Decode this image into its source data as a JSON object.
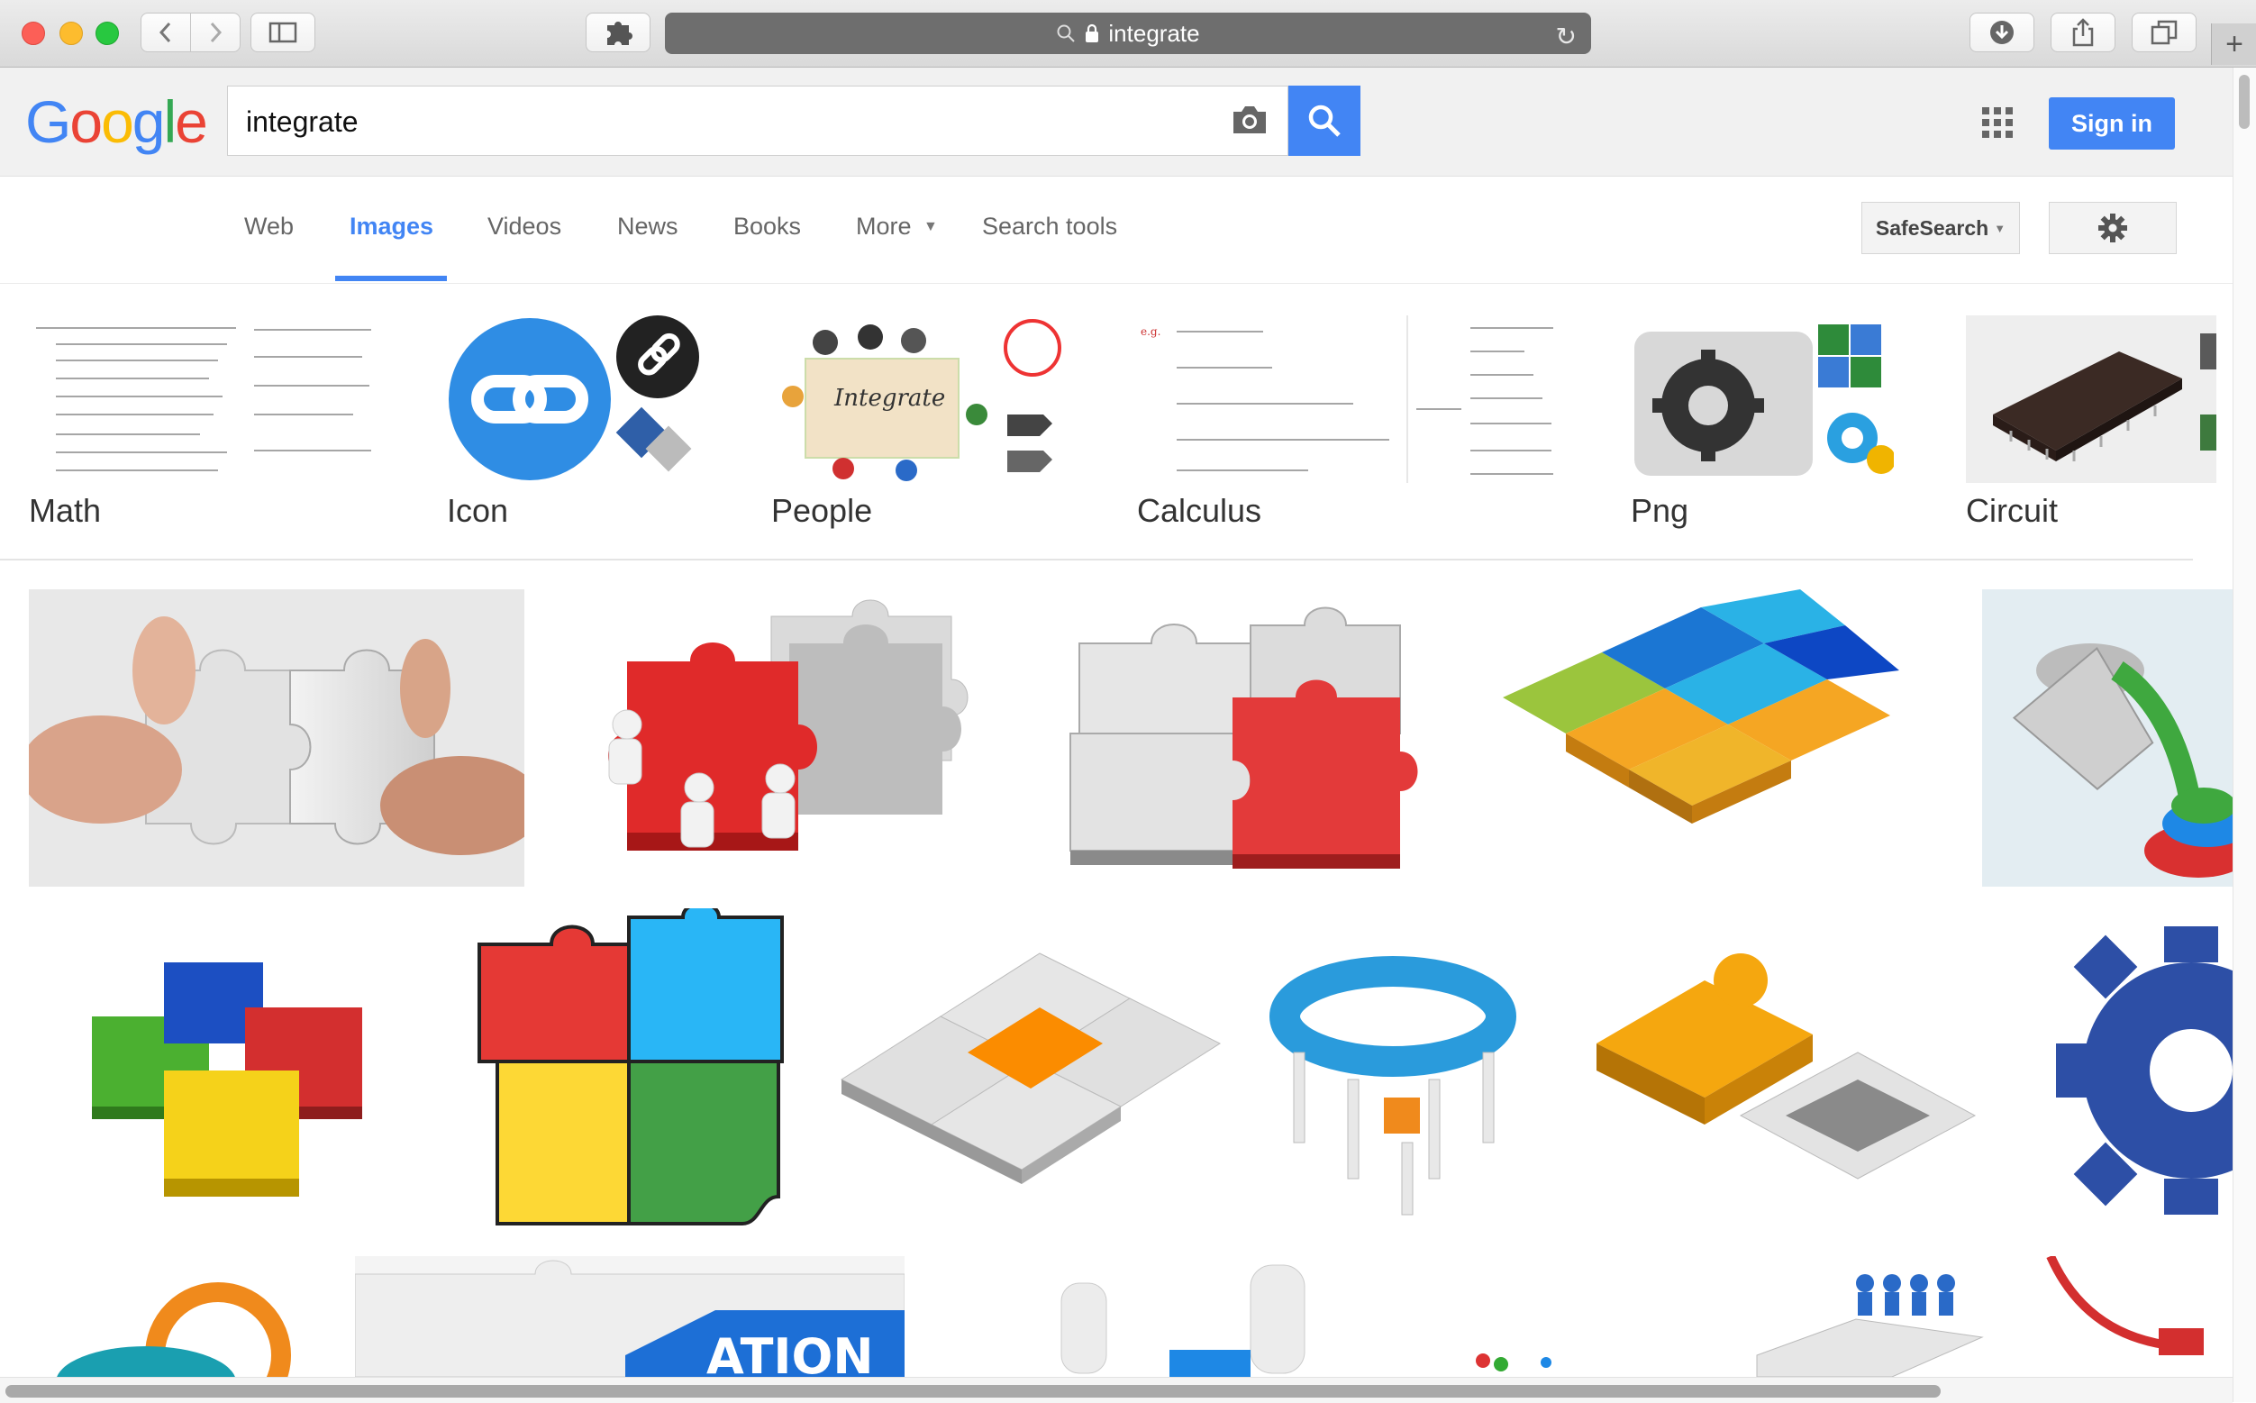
{
  "browser": {
    "address": "integrate"
  },
  "header": {
    "logo_letters": [
      "G",
      "o",
      "o",
      "g",
      "l",
      "e"
    ],
    "logo_colors": [
      "#4285f4",
      "#ea4335",
      "#fbbc05",
      "#4285f4",
      "#34a853",
      "#ea4335"
    ],
    "search_value": "integrate",
    "signin_label": "Sign in"
  },
  "tabs": [
    {
      "label": "Web"
    },
    {
      "label": "Images"
    },
    {
      "label": "Videos"
    },
    {
      "label": "News"
    },
    {
      "label": "Books"
    },
    {
      "label": "More"
    },
    {
      "label": "Search tools"
    }
  ],
  "active_tab": "Images",
  "safesearch_label": "SafeSearch",
  "related": [
    {
      "label": "Math"
    },
    {
      "label": "Icon"
    },
    {
      "label": "People"
    },
    {
      "label": "Calculus"
    },
    {
      "label": "Png"
    },
    {
      "label": "Circuit"
    }
  ],
  "colors": {
    "accent": "#4285f4",
    "puzzle_red": "#e53935",
    "puzzle_blue": "#1e88e5",
    "puzzle_yellow": "#fbc02d",
    "puzzle_green": "#43a047",
    "puzzle_orange": "#fb8c00"
  }
}
